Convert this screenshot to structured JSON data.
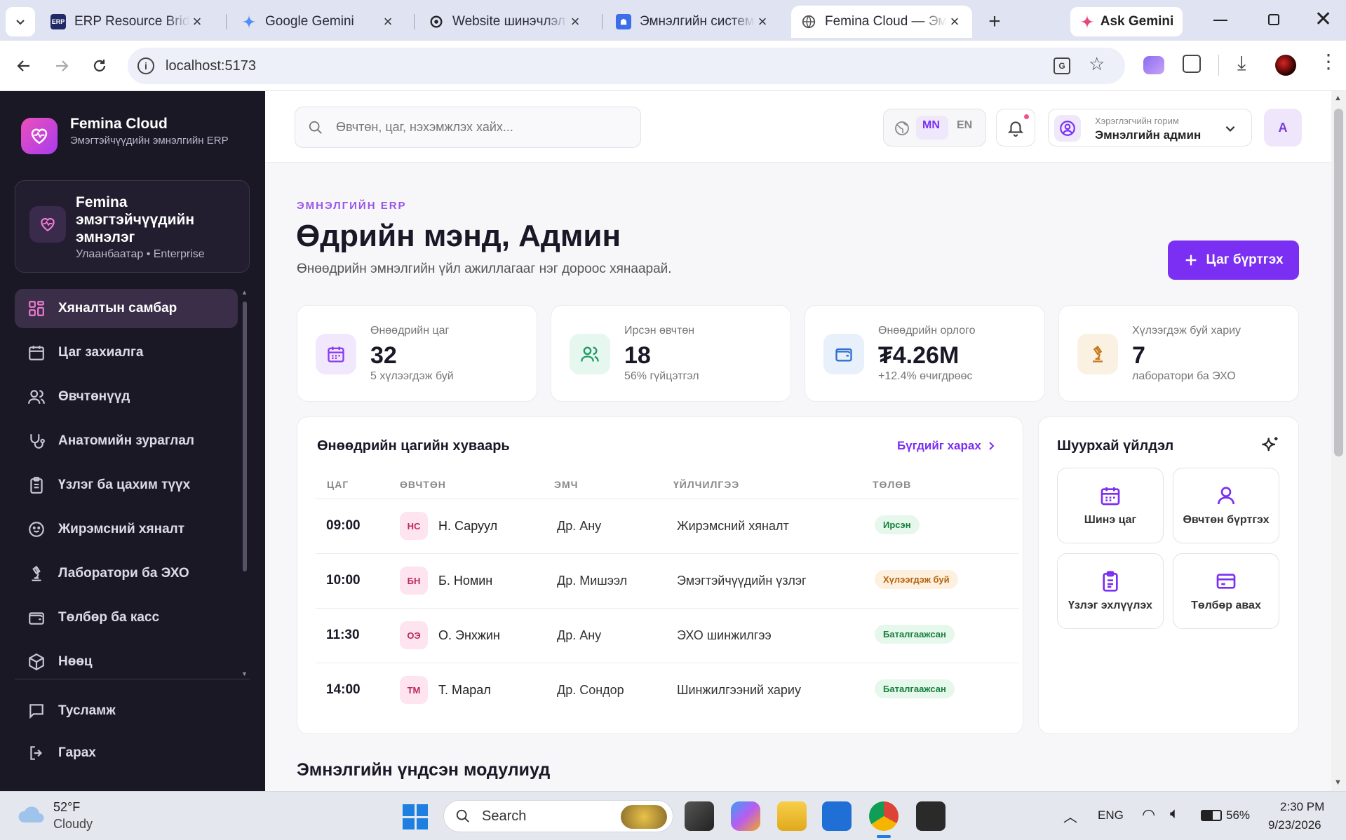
{
  "browser": {
    "tabs": [
      {
        "title": "ERP Resource Bridge",
        "fav": "ERP"
      },
      {
        "title": "Google Gemini",
        "fav": "gemini"
      },
      {
        "title": "Website шинэчлэлт",
        "fav": "openai"
      },
      {
        "title": "Эмнэлгийн систем",
        "fav": "app"
      },
      {
        "title": "Femina Cloud — Эм",
        "fav": "globe"
      }
    ],
    "ask_gemini": "Ask Gemini",
    "url": "localhost:5173"
  },
  "sidebar": {
    "brand_name": "Femina Cloud",
    "brand_sub": "Эмэгтэйчүүдийн эмнэлгийн ERP",
    "clinic_name": "Femina эмэгтэйчүүдийн эмнэлэг",
    "clinic_location": "Улаанбаатар • Enterprise",
    "items": [
      {
        "label": "Хяналтын самбар",
        "icon": "grid-icon"
      },
      {
        "label": "Цаг захиалга",
        "icon": "calendar-icon"
      },
      {
        "label": "Өвчтөнүүд",
        "icon": "users-icon"
      },
      {
        "label": "Анатомийн зураглал",
        "icon": "stethoscope-icon"
      },
      {
        "label": "Үзлэг ба цахим түүх",
        "icon": "clipboard-icon"
      },
      {
        "label": "Жирэмсний хяналт",
        "icon": "baby-icon"
      },
      {
        "label": "Лаборатори ба ЭХО",
        "icon": "microscope-icon"
      },
      {
        "label": "Төлбөр ба касс",
        "icon": "wallet-icon"
      },
      {
        "label": "Нөөц",
        "icon": "box-icon"
      }
    ],
    "help": "Тусламж",
    "logout": "Гарах"
  },
  "topbar": {
    "search_placeholder": "Өвчтөн, цаг, нэхэмжлэх хайх...",
    "lang_mn": "MN",
    "lang_en": "EN",
    "role_label": "Хэрэглэгчийн горим",
    "role_value": "Эмнэлгийн админ",
    "avatar": "A"
  },
  "hero": {
    "kicker": "ЭМНЭЛГИЙН ERP",
    "title": "Өдрийн мэнд, Админ",
    "subtitle": "Өнөөдрийн эмнэлгийн үйл ажиллагааг нэг дороос хянаарай.",
    "add_button": "Цаг бүртгэх"
  },
  "stats": [
    {
      "label": "Өнөөдрийн цаг",
      "value": "32",
      "sub": "5 хүлээгдэж буй"
    },
    {
      "label": "Ирсэн өвчтөн",
      "value": "18",
      "sub": "56% гүйцэтгэл"
    },
    {
      "label": "Өнөөдрийн орлого",
      "value": "₮4.26M",
      "sub": "+12.4% өчигдрөөс"
    },
    {
      "label": "Хүлээгдэж буй хариу",
      "value": "7",
      "sub": "лаборатори ба ЭХО"
    }
  ],
  "schedule": {
    "title": "Өнөөдрийн цагийн хуваарь",
    "view_all": "Бүгдийг харах",
    "headers": [
      "ЦАГ",
      "ӨВЧТӨН",
      "ЭМЧ",
      "ҮЙЛЧИЛГЭЭ",
      "ТӨЛӨВ"
    ],
    "rows": [
      {
        "time": "09:00",
        "initials": "НС",
        "patient": "Н. Саруул",
        "doctor": "Др. Ану",
        "service": "Жирэмсний хяналт",
        "status": "Ирсэн"
      },
      {
        "time": "10:00",
        "initials": "БН",
        "patient": "Б. Номин",
        "doctor": "Др. Мишээл",
        "service": "Эмэгтэйчүүдийн үзлэг",
        "status": "Хүлээгдэж буй"
      },
      {
        "time": "11:30",
        "initials": "ОЭ",
        "patient": "О. Энхжин",
        "doctor": "Др. Ану",
        "service": "ЭХО шинжилгээ",
        "status": "Баталгаажсан"
      },
      {
        "time": "14:00",
        "initials": "ТМ",
        "patient": "Т. Марал",
        "doctor": "Др. Сондор",
        "service": "Шинжилгээний хариу",
        "status": "Баталгаажсан"
      }
    ]
  },
  "quick": {
    "title": "Шуурхай үйлдэл",
    "actions": [
      "Шинэ цаг",
      "Өвчтөн бүртгэх",
      "Үзлэг эхлүүлэх",
      "Төлбөр авах"
    ]
  },
  "modules_title": "Эмнэлгийн үндсэн модулиуд",
  "taskbar": {
    "temp": "52°F",
    "weather": "Cloudy",
    "search": "Search",
    "lang": "ENG",
    "battery": "56%",
    "time": "2:30 PM",
    "date": "9/23/2026"
  },
  "colors": {
    "accent": "#7b2ff2",
    "sidebar_bg": "#1b1826",
    "brand_gradient": "#ec4fb9"
  }
}
